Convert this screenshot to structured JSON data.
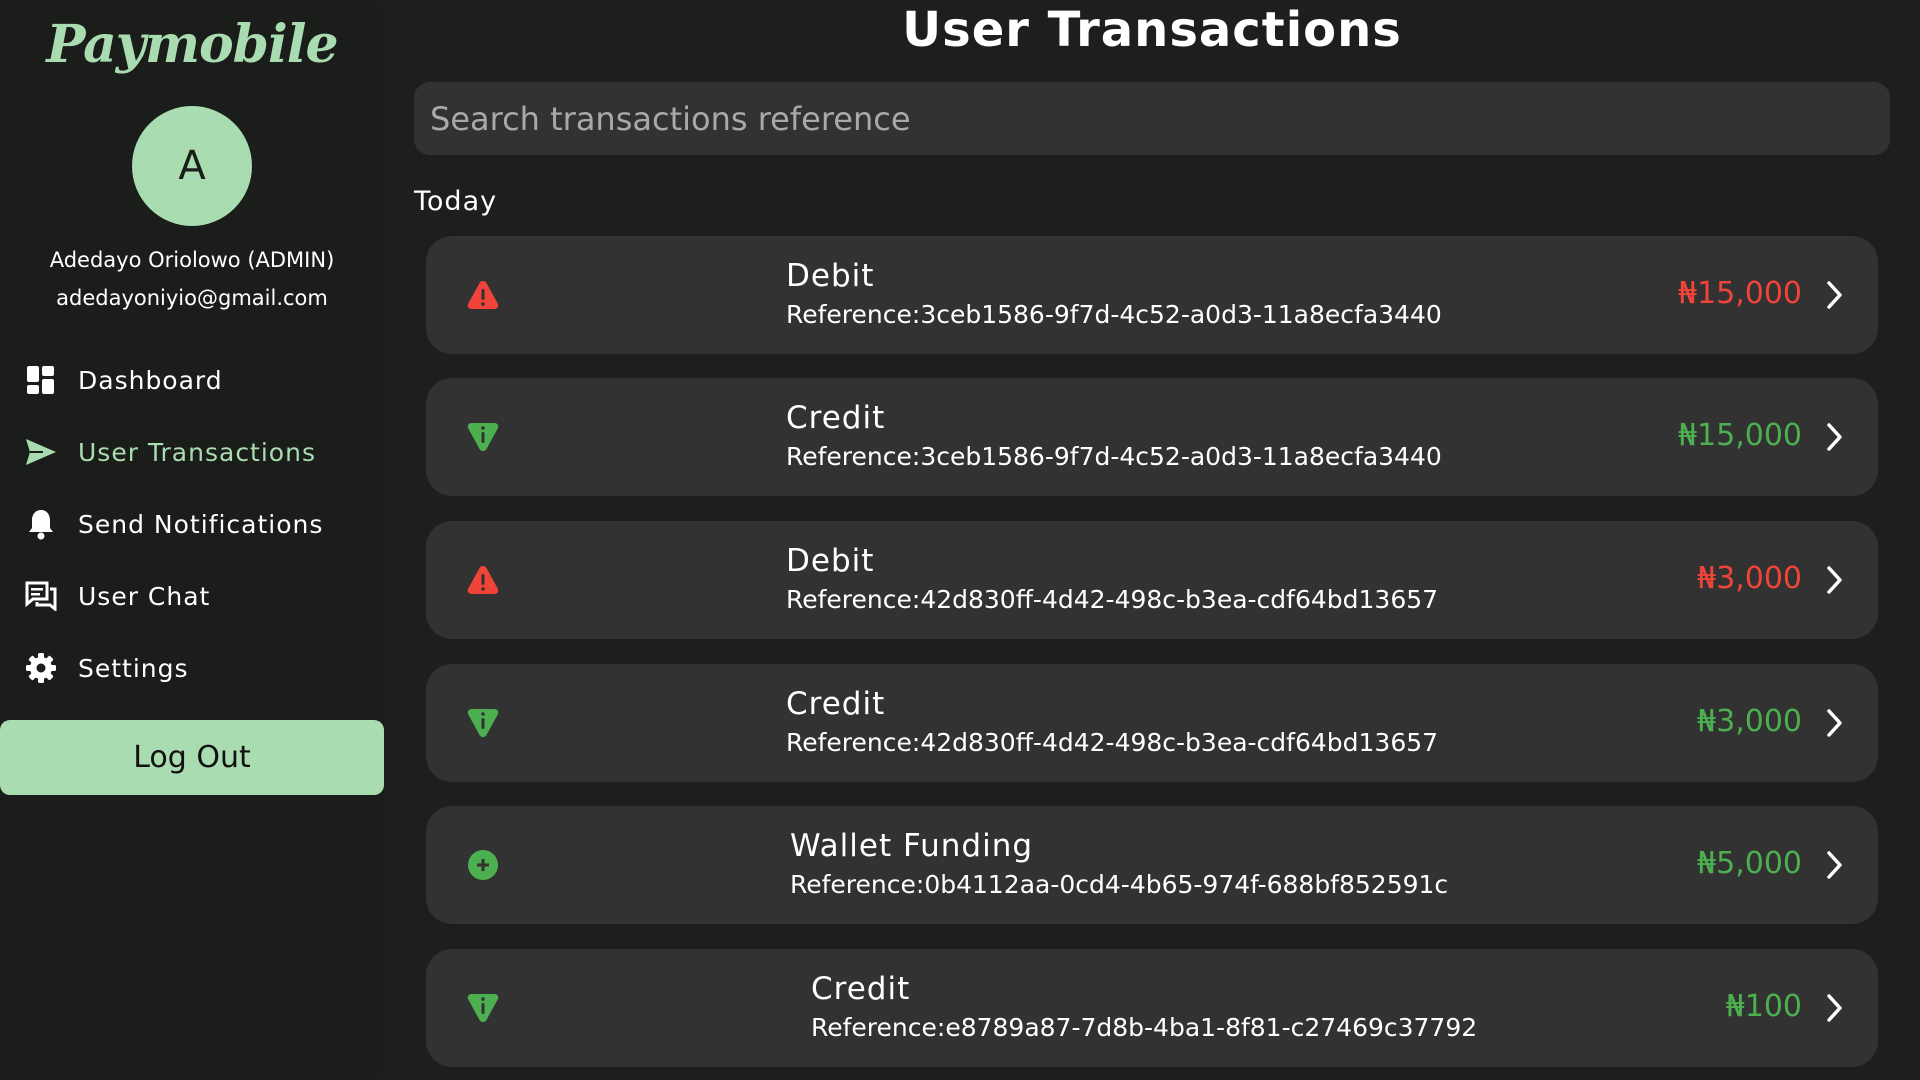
{
  "brand": "Paymobile",
  "user": {
    "initial": "A",
    "name": "Adedayo Oriolowo (ADMIN)",
    "email": "adedayoniyio@gmail.com"
  },
  "nav": [
    {
      "label": "Dashboard",
      "icon": "dashboard-icon"
    },
    {
      "label": "User Transactions",
      "icon": "send-icon",
      "active": true
    },
    {
      "label": "Send Notifications",
      "icon": "bell-icon"
    },
    {
      "label": "User Chat",
      "icon": "chat-icon"
    },
    {
      "label": "Settings",
      "icon": "gear-icon"
    }
  ],
  "logout_label": "Log Out",
  "page_title": "User Transactions",
  "search": {
    "placeholder": "Search transactions reference"
  },
  "section": "Today",
  "transactions": [
    {
      "type": "Debit",
      "reference": "Reference:3ceb1586-9f7d-4c52-a0d3-11a8ecfa3440",
      "amount": "₦15,000",
      "status": "debit",
      "icon": "warning-icon"
    },
    {
      "type": "Credit",
      "reference": "Reference:3ceb1586-9f7d-4c52-a0d3-11a8ecfa3440",
      "amount": "₦15,000",
      "status": "credit",
      "icon": "credit-icon"
    },
    {
      "type": "Debit",
      "reference": "Reference:42d830ff-4d42-498c-b3ea-cdf64bd13657",
      "amount": "₦3,000",
      "status": "debit",
      "icon": "warning-icon"
    },
    {
      "type": "Credit",
      "reference": "Reference:42d830ff-4d42-498c-b3ea-cdf64bd13657",
      "amount": "₦3,000",
      "status": "credit",
      "icon": "credit-icon"
    },
    {
      "type": "Wallet Funding",
      "reference": "Reference:0b4112aa-0cd4-4b65-974f-688bf852591c",
      "amount": "₦5,000",
      "status": "funding",
      "icon": "plus-circle-icon"
    },
    {
      "type": "Credit",
      "reference": "Reference:e8789a87-7d8b-4ba1-8f81-c27469c37792",
      "amount": "₦100",
      "status": "credit",
      "icon": "credit-icon"
    }
  ],
  "colors": {
    "accent": "#a9dcb0",
    "debit": "#f0443a",
    "credit": "#4caf50",
    "card": "#323232",
    "background": "#1e1e1e"
  }
}
